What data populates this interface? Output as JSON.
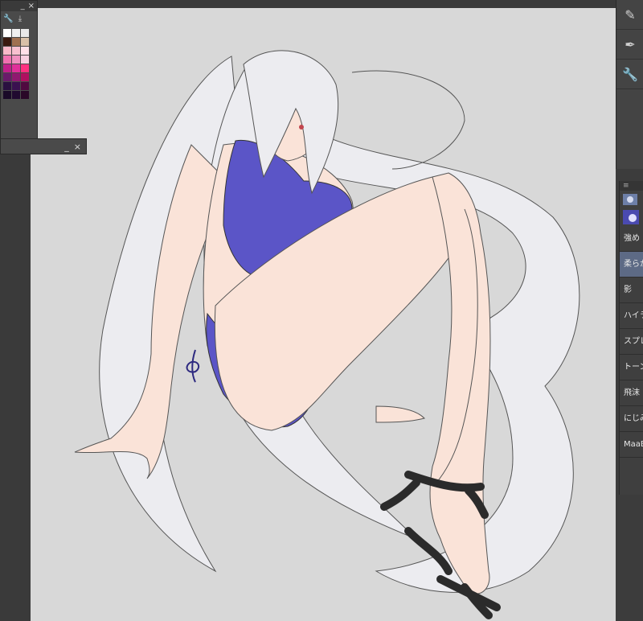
{
  "palette_panel": {
    "minimize_label": "_",
    "close_label": "×",
    "swatches": [
      "#ffffff",
      "#f0f0f0",
      "#e8e8e8",
      "#3a1a10",
      "#a07050",
      "#d8c0a8",
      "#f8b8c8",
      "#f8c0d0",
      "#ffe0e8",
      "#f070b0",
      "#f090c0",
      "#f8d0e0",
      "#c0208a",
      "#e0309a",
      "#ff3080",
      "#6a1a6a",
      "#901870",
      "#b01060",
      "#2a1040",
      "#3a1050",
      "#500a40",
      "#1a0a28",
      "#200a30",
      "#2a0828"
    ],
    "icons": [
      "wrench-icon",
      "import-icon"
    ],
    "bottom_icons": [
      "fill-icon",
      "trash-icon"
    ]
  },
  "float_strip": {
    "minimize_label": "_",
    "close_label": "×"
  },
  "right_tools": [
    "pen-settings-icon",
    "pen-gear-icon",
    "wrench-icon"
  ],
  "brush_panel": {
    "items": [
      {
        "label": "強め"
      },
      {
        "label": "柔らか",
        "selected": true
      },
      {
        "label": "影"
      },
      {
        "label": "ハイラ"
      },
      {
        "label": "スプレ"
      },
      {
        "label": "トーン"
      },
      {
        "label": "飛沫"
      },
      {
        "label": "にじみ"
      },
      {
        "label": "MaaB"
      }
    ]
  },
  "colors": {
    "canvas_bg": "#d8d8d8",
    "hair": "#ececf0",
    "skin": "#fae3d8",
    "swimsuit": "#5b55c7",
    "sandals": "#2b2b2b",
    "line": "#555555"
  }
}
